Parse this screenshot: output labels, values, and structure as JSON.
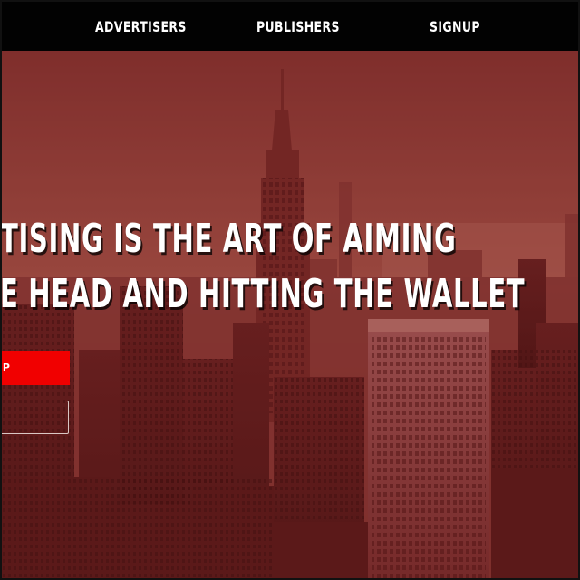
{
  "nav": {
    "advertisers": "ADVERTISERS",
    "publishers": "PUBLISHERS",
    "signup": "SIGNUP"
  },
  "hero": {
    "headline_line1": "TISING IS THE ART OF AIMING",
    "headline_line2": "E HEAD AND HITTING THE WALLET",
    "primary_button": "UP",
    "secondary_button": ")"
  },
  "colors": {
    "nav_bg": "#020202",
    "overlay": "#8a2a24",
    "cta_red": "#f10000",
    "text": "#ffffff"
  }
}
